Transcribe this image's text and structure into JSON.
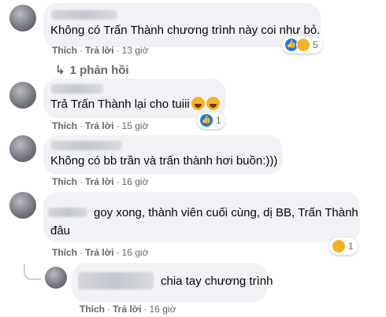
{
  "comments": [
    {
      "text": "Không có Trấn Thành chương trình này coi như bỏ.",
      "like": "Thích",
      "reply": "Trả lời",
      "time": "13 giờ",
      "reaction_count": "5",
      "reactions": [
        "like",
        "haha"
      ]
    },
    {
      "text": "Trả Trấn Thành lại cho tuiii",
      "like": "Thích",
      "reply": "Trả lời",
      "time": "15 giờ",
      "reaction_count": "1",
      "reactions": [
        "like"
      ]
    },
    {
      "text": "Không có bb trần và trấn thành hơi buồn:)))",
      "like": "Thích",
      "reply": "Trả lời",
      "time": "16 giờ"
    },
    {
      "text_line1": "goy xong, thành viên cuối cùng, dị BB, Trấn Thành",
      "text_line2": "đâu",
      "like": "Thích",
      "reply": "Trả lời",
      "time": "16 giờ",
      "reaction_count": "1",
      "reactions": [
        "sad"
      ]
    },
    {
      "text": "chia tay chương trình",
      "like": "Thích",
      "reply": "Trả lời",
      "time": "16 giờ"
    }
  ],
  "replies_label": "1 phản hồi",
  "colors": {
    "bubble": "#f0f2f5",
    "meta": "#65676b",
    "like_blue": "#1877f2"
  }
}
